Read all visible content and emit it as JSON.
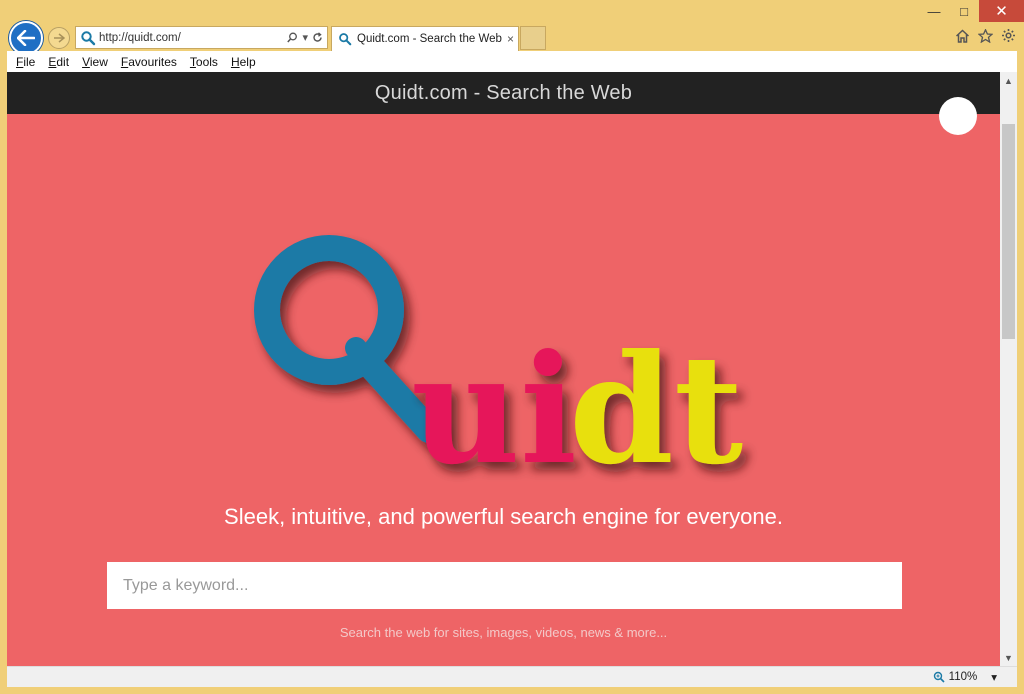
{
  "browser": {
    "address_url": "http://quidt.com/",
    "tab_title": "Quidt.com - Search the Web",
    "tab_close": "×",
    "menu": [
      "File",
      "Edit",
      "View",
      "Favourites",
      "Tools",
      "Help"
    ],
    "zoom_level": "110%",
    "window_controls": {
      "minimize": "—",
      "maximize": "□",
      "close": "✕"
    }
  },
  "page": {
    "header_title": "Quidt.com - Search the Web",
    "logo_text": "Quidt",
    "tagline": "Sleek, intuitive, and powerful search engine for everyone.",
    "search_placeholder": "Type a keyword...",
    "search_hint": "Search the web for sites, images, videos, news & more..."
  },
  "colors": {
    "page_background": "#ee6466",
    "header_bar": "#222222",
    "logo_q": "#1b7aa6",
    "logo_ui": "#e6165a",
    "logo_dt": "#e8e00c",
    "frame": "#f0cf78"
  },
  "icons": [
    "back-arrow-icon",
    "forward-arrow-icon",
    "search-icon",
    "dropdown-icon",
    "refresh-icon",
    "home-icon",
    "favorites-star-icon",
    "settings-gear-icon",
    "zoom-icon"
  ]
}
